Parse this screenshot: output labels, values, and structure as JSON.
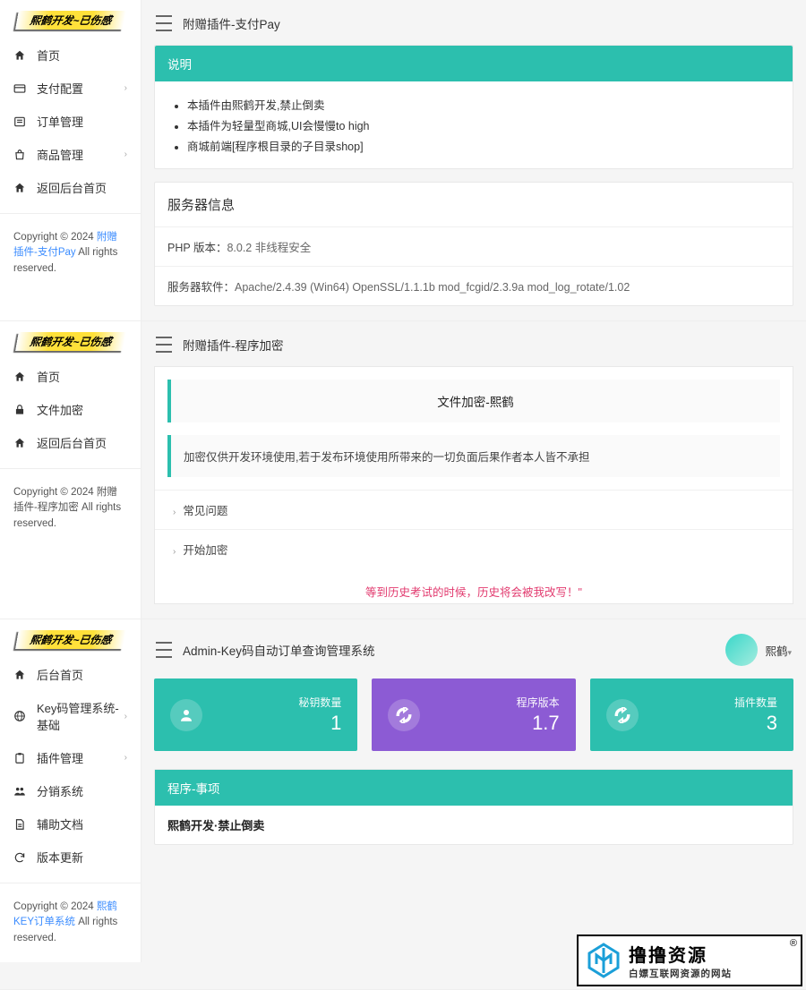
{
  "brand_badge": "熙鹤开发~已伤感",
  "section1": {
    "nav": [
      {
        "label": "首页",
        "icon": "home-icon",
        "expandable": false
      },
      {
        "label": "支付配置",
        "icon": "card-icon",
        "expandable": true
      },
      {
        "label": "订单管理",
        "icon": "list-icon",
        "expandable": false
      },
      {
        "label": "商品管理",
        "icon": "bag-icon",
        "expandable": true
      },
      {
        "label": "返回后台首页",
        "icon": "home-icon",
        "expandable": false
      }
    ],
    "copyright_prefix": "Copyright © 2024 ",
    "copyright_link": "附赠插件-支付Pay",
    "copyright_suffix": " All rights reserved.",
    "page_title": "附赠插件-支付Pay",
    "info_header": "说明",
    "info_items": [
      "本插件由熙鹤开发,禁止倒卖",
      "本插件为轻量型商城,UI会慢慢to high",
      "商城前端[程序根目录的子目录shop]"
    ],
    "server_title": "服务器信息",
    "server_rows": [
      {
        "label": "PHP 版本：",
        "value": "8.0.2 非线程安全"
      },
      {
        "label": "服务器软件：",
        "value": "Apache/2.4.39 (Win64) OpenSSL/1.1.1b mod_fcgid/2.3.9a mod_log_rotate/1.02"
      }
    ]
  },
  "section2": {
    "nav": [
      {
        "label": "首页",
        "icon": "home-icon",
        "expandable": false
      },
      {
        "label": "文件加密",
        "icon": "lock-icon",
        "expandable": false
      },
      {
        "label": "返回后台首页",
        "icon": "home-icon",
        "expandable": false
      }
    ],
    "copyright_prefix": "Copyright © 2024 附赠插件-程序加密 All rights reserved.",
    "page_title": "附赠插件-程序加密",
    "fe_title": "文件加密-熙鹤",
    "fe_warn": "加密仅供开发环境使用,若于发布环境使用所带来的一切负面后果作者本人皆不承担",
    "fe_rows": [
      "常见问题",
      "开始加密"
    ],
    "fe_quote": "等到历史考试的时候，历史将会被我改写！\""
  },
  "section3": {
    "nav": [
      {
        "label": "后台首页",
        "icon": "home-icon",
        "expandable": false
      },
      {
        "label": "Key码管理系统-基础",
        "icon": "globe-icon",
        "expandable": true
      },
      {
        "label": "插件管理",
        "icon": "clipboard-icon",
        "expandable": true
      },
      {
        "label": "分销系统",
        "icon": "users-icon",
        "expandable": false
      },
      {
        "label": "辅助文档",
        "icon": "doc-icon",
        "expandable": false
      },
      {
        "label": "版本更新",
        "icon": "refresh-icon",
        "expandable": false
      }
    ],
    "copyright_prefix": "Copyright © 2024 ",
    "copyright_link": "熙鹤KEY订单系统",
    "copyright_suffix": " All rights reserved.",
    "page_title": "Admin-Key码自动订单查询管理系统",
    "user_name": "熙鹤",
    "stats": [
      {
        "label": "秘钥数量",
        "value": "1",
        "color": "teal",
        "icon": "person-icon"
      },
      {
        "label": "程序版本",
        "value": "1.7",
        "color": "purple",
        "icon": "loop-icon"
      },
      {
        "label": "插件数量",
        "value": "3",
        "color": "teal",
        "icon": "loop-icon"
      }
    ],
    "proj_header": "程序-事项",
    "proj_body": "熙鹤开发·禁止倒卖"
  },
  "watermark": {
    "main": "撸撸资源",
    "sub": "白嫖互联网资源的网站",
    "r": "®"
  }
}
